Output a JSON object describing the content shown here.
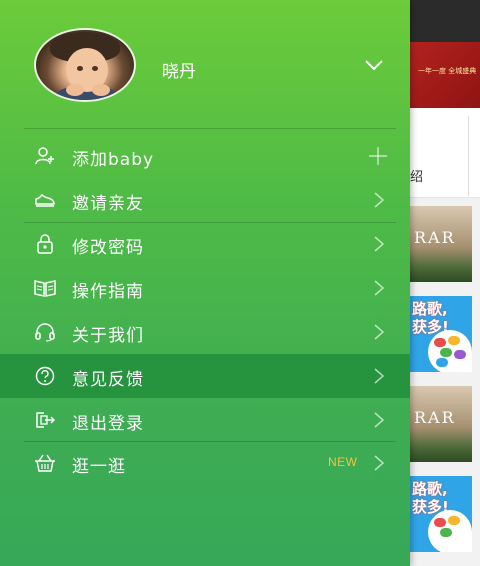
{
  "profile": {
    "username": "晓丹"
  },
  "menu": {
    "items": [
      {
        "label": "添加baby",
        "icon": "add-user-icon",
        "trailing": "plus"
      },
      {
        "label": "邀请亲友",
        "icon": "shoe-icon",
        "trailing": "arrow"
      },
      {
        "label": "修改密码",
        "icon": "lock-icon",
        "trailing": "arrow"
      },
      {
        "label": "操作指南",
        "icon": "book-icon",
        "trailing": "arrow"
      },
      {
        "label": "关于我们",
        "icon": "headset-icon",
        "trailing": "arrow"
      },
      {
        "label": "意见反馈",
        "icon": "question-icon",
        "trailing": "arrow",
        "active": true
      },
      {
        "label": "退出登录",
        "icon": "logout-icon",
        "trailing": "arrow"
      },
      {
        "label": "逛一逛",
        "icon": "basket-icon",
        "trailing": "arrow",
        "badge": "NEW"
      }
    ]
  },
  "background_app": {
    "tab_partial_label": "绍",
    "banner_text": "一年一度  全城盛典",
    "card_mansion_text": "RAR",
    "card_blue_text_line1": "路歌,",
    "card_blue_text_line2": "获多!"
  },
  "colors": {
    "drawer_top": "#6ccb3a",
    "drawer_bottom": "#36a858",
    "active_row": "#26933e",
    "new_badge": "#f5c242"
  }
}
